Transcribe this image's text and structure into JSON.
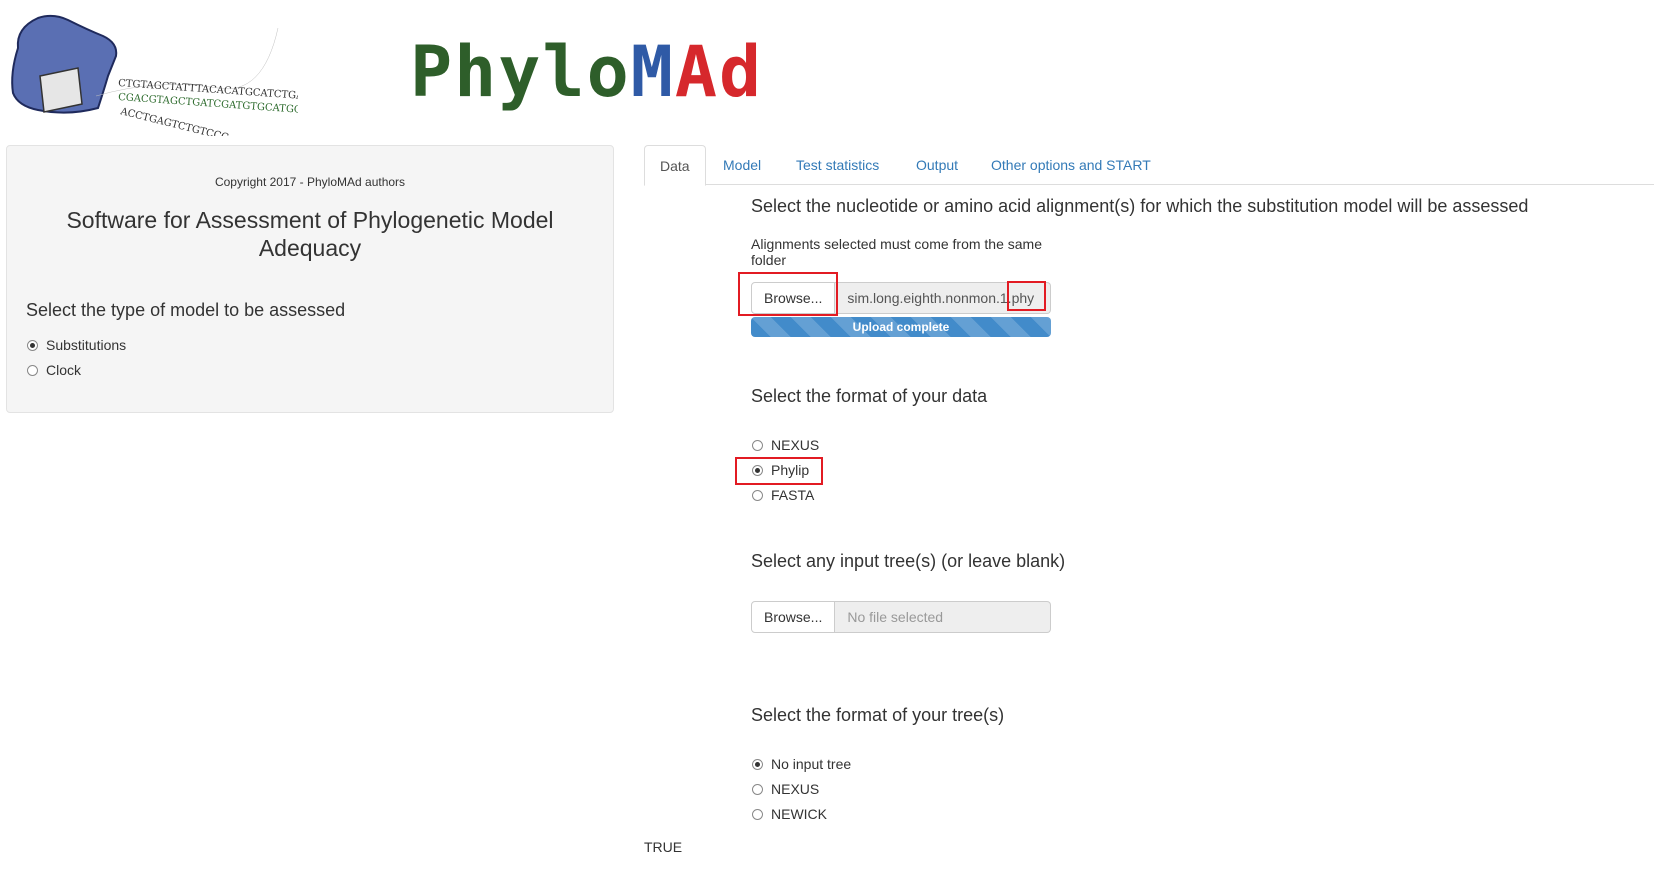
{
  "header": {
    "logo_sequence": [
      "CTGTAGCTATTTACACATGCATCTGA",
      "CGACGTAGCTGATCGATGTGCATGC",
      "ACCTGAGTCTGTCCC"
    ],
    "title_parts": [
      "Phylo",
      "M",
      "A",
      "d"
    ]
  },
  "sidebar": {
    "copyright": "Copyright 2017 - PhyloMAd authors",
    "software_title": "Software for Assessment of Phylogenetic Model Adequacy",
    "model_type_heading": "Select the type of model to be assessed",
    "model_options": [
      {
        "label": "Substitutions",
        "selected": true
      },
      {
        "label": "Clock",
        "selected": false
      }
    ]
  },
  "tabs": [
    {
      "label": "Data",
      "active": true
    },
    {
      "label": "Model",
      "active": false
    },
    {
      "label": "Test statistics",
      "active": false
    },
    {
      "label": "Output",
      "active": false
    },
    {
      "label": "Other options and START",
      "active": false
    }
  ],
  "data_tab": {
    "alignment_heading": "Select the nucleotide or amino acid alignment(s) for which the substitution model will be assessed",
    "alignment_note": "Alignments selected must come from the same folder",
    "alignment_browse": "Browse...",
    "alignment_file": "sim.long.eighth.nonmon.1.phy",
    "upload_status": "Upload complete",
    "upload_progress": 1.0,
    "format_heading": "Select the format of your data",
    "format_options": [
      {
        "label": "NEXUS",
        "selected": false
      },
      {
        "label": "Phylip",
        "selected": true
      },
      {
        "label": "FASTA",
        "selected": false
      }
    ],
    "tree_heading": "Select any input tree(s) (or leave blank)",
    "tree_browse": "Browse...",
    "tree_placeholder": "No file selected",
    "tree_format_heading": "Select the format of your tree(s)",
    "tree_format_options": [
      {
        "label": "No input tree",
        "selected": true
      },
      {
        "label": "NEXUS",
        "selected": false
      },
      {
        "label": "NEWICK",
        "selected": false
      }
    ]
  },
  "output_value": "TRUE",
  "colors": {
    "link": "#337ab7",
    "title_green": "#2e5e2a",
    "title_blue": "#2f5aa6",
    "title_red": "#d6282c",
    "progress": "#428bca",
    "highlight": "#e21b23"
  }
}
